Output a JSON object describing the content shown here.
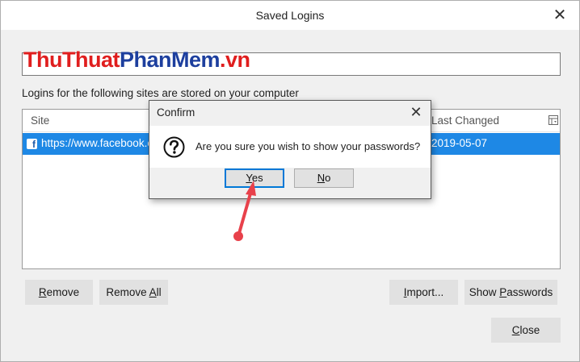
{
  "window": {
    "title": "Saved Logins",
    "close_glyph": "✕"
  },
  "watermark": {
    "part1": "ThuThuat",
    "part2": "PhanMem",
    "part3": ".vn"
  },
  "description": "Logins for the following sites are stored on your computer",
  "table": {
    "columns": [
      "Site",
      "Last Changed"
    ],
    "rows": [
      {
        "icon": "facebook-icon",
        "site": "https://www.facebook.c",
        "last_changed": "2019-05-07",
        "selected": true
      }
    ]
  },
  "buttons": {
    "remove": {
      "pre": "",
      "u": "R",
      "post": "emove"
    },
    "remove_all": {
      "pre": "Remove ",
      "u": "A",
      "post": "ll"
    },
    "import": {
      "pre": "",
      "u": "I",
      "post": "mport..."
    },
    "show_passwords": {
      "pre": "Show ",
      "u": "P",
      "post": "asswords"
    },
    "close": {
      "pre": "",
      "u": "C",
      "post": "lose"
    }
  },
  "confirm_dialog": {
    "title": "Confirm",
    "close_glyph": "✕",
    "icon": "question-icon",
    "message": "Are you sure you wish to show your passwords?",
    "yes": {
      "u": "Y",
      "post": "es"
    },
    "no": {
      "u": "N",
      "post": "o"
    }
  },
  "colors": {
    "selection": "#1e88e5",
    "dialog_focus": "#0078d7",
    "annotation_arrow": "#e8414b"
  }
}
